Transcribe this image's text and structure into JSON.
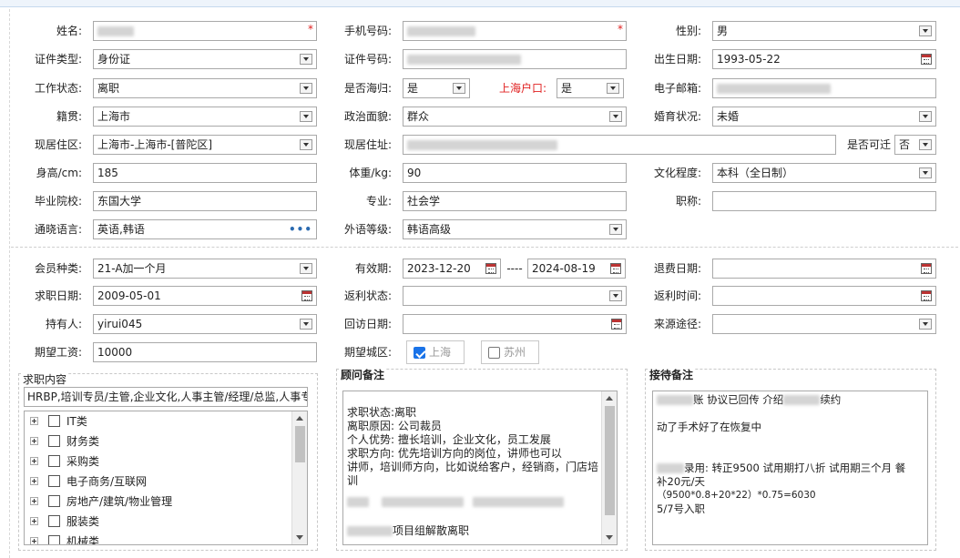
{
  "personal": {
    "name_label": "姓名:",
    "phone_label": "手机号码:",
    "gender_label": "性别:",
    "gender_value": "男",
    "id_type_label": "证件类型:",
    "id_type_value": "身份证",
    "id_no_label": "证件号码:",
    "birth_label": "出生日期:",
    "birth_value": "1993-05-22",
    "work_status_label": "工作状态:",
    "work_status_value": "离职",
    "returnee_label": "是否海归:",
    "returnee_value": "是",
    "hukou_label": "上海户口:",
    "hukou_value": "是",
    "email_label": "电子邮箱:",
    "native_label": "籍贯:",
    "native_value": "上海市",
    "political_label": "政治面貌:",
    "political_value": "群众",
    "marital_label": "婚育状况:",
    "marital_value": "未婚",
    "residence_label": "现居住区:",
    "residence_value": "上海市-上海市-[普陀区]",
    "address_label": "现居住址:",
    "relocate_label": "是否可迁",
    "relocate_value": "否",
    "height_label": "身高/cm:",
    "height_value": "185",
    "weight_label": "体重/kg:",
    "weight_value": "90",
    "education_label": "文化程度:",
    "education_value": "本科（全日制）",
    "school_label": "毕业院校:",
    "school_value": "东国大学",
    "major_label": "专业:",
    "major_value": "社会学",
    "title_label": "职称:",
    "language_label": "通晓语言:",
    "language_value": "英语,韩语",
    "language_more": "•••",
    "foreign_level_label": "外语等级:",
    "foreign_level_value": "韩语高级"
  },
  "membership": {
    "member_type_label": "会员种类:",
    "member_type_value": "21-A加一个月",
    "valid_label": "有效期:",
    "valid_from": "2023-12-20",
    "valid_sep": "----",
    "valid_to": "2024-08-19",
    "refund_date_label": "退费日期:",
    "job_date_label": "求职日期:",
    "job_date_value": "2009-05-01",
    "rebate_status_label": "返利状态:",
    "rebate_time_label": "返利时间:",
    "holder_label": "持有人:",
    "holder_value": "yirui045",
    "visit_date_label": "回访日期:",
    "source_label": "来源途径:",
    "salary_label": "期望工资:",
    "salary_value": "10000",
    "city_label": "期望城区:",
    "city_shanghai": "上海",
    "city_suzhou": "苏州"
  },
  "job_content": {
    "title": "求职内容",
    "field_value": "HRBP,培训专员/主管,企业文化,人事主管/经理/总监,人事专",
    "tree_items": [
      "IT类",
      "财务类",
      "采购类",
      "电子商务/互联网",
      "房地产/建筑/物业管理",
      "服装类",
      "机械类"
    ]
  },
  "consultant_notes": {
    "title": "顾问备注",
    "lines": [
      "求职状态:离职",
      "离职原因: 公司裁员",
      "个人优势: 擅长培训，企业文化，员工发展",
      "求职方向: 优先培训方向的岗位，讲师也可以",
      "讲师，培训师方向，比如说给客户，经销商，门店培",
      "训"
    ],
    "last_line_suffix": "项目组解散离职"
  },
  "reception_notes": {
    "title": "接待备注",
    "line1_mid": "账 协议已回传 介绍",
    "line1_end": "续约",
    "line2": "动了手术好了在恢复中",
    "line3_mid": "录用:  转正9500 试用期打八折 试用期三个月 餐",
    "line4": "补20元/天",
    "line5": "（9500*0.8+20*22）*0.75=6030",
    "line6": "5/7号入职"
  },
  "colors": {
    "required_star": "#e02020",
    "accent": "#1a73e8"
  }
}
